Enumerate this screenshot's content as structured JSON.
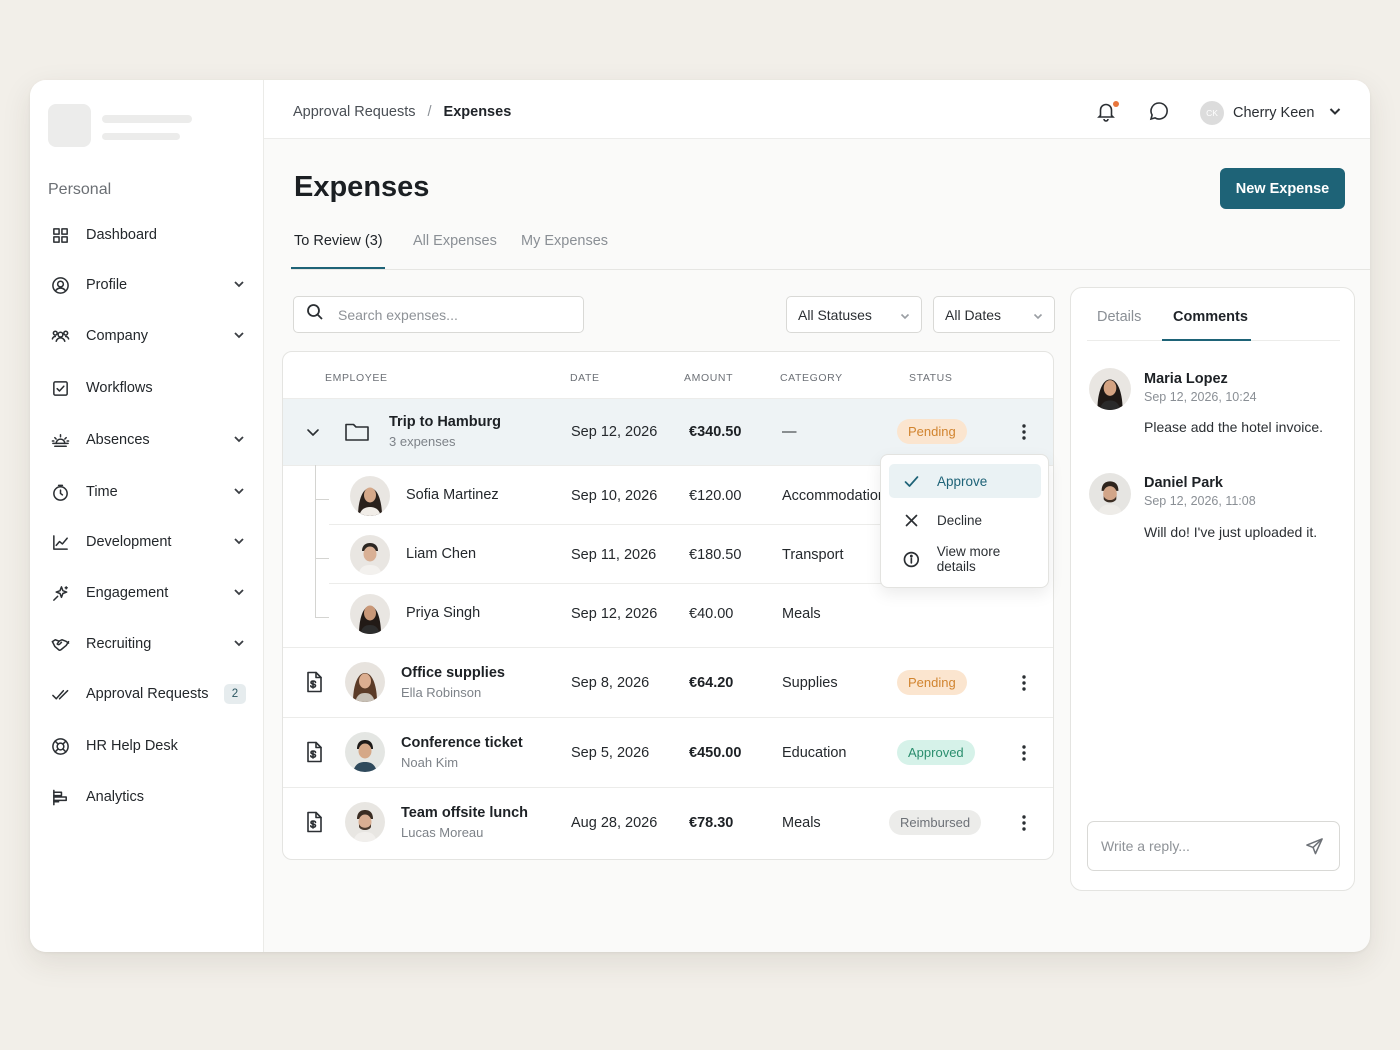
{
  "sidebar": {
    "section": "Personal",
    "items": [
      {
        "label": "Dashboard",
        "icon": "grid-icon",
        "chevron": false
      },
      {
        "label": "Profile",
        "icon": "user-circle-icon",
        "chevron": true
      },
      {
        "label": "Company",
        "icon": "users-icon",
        "chevron": true
      },
      {
        "label": "Workflows",
        "icon": "checkbox-icon",
        "chevron": false
      },
      {
        "label": "Absences",
        "icon": "sunrise-icon",
        "chevron": true
      },
      {
        "label": "Time",
        "icon": "stopwatch-icon",
        "chevron": true
      },
      {
        "label": "Development",
        "icon": "chart-line-icon",
        "chevron": true
      },
      {
        "label": "Engagement",
        "icon": "sparkle-icon",
        "chevron": true
      },
      {
        "label": "Recruiting",
        "icon": "handshake-icon",
        "chevron": true
      },
      {
        "label": "Approval Requests",
        "icon": "double-check-icon",
        "chevron": false,
        "badge": "2"
      },
      {
        "label": "HR Help Desk",
        "icon": "lifebuoy-icon",
        "chevron": false
      },
      {
        "label": "Analytics",
        "icon": "bar-chart-icon",
        "chevron": false
      }
    ]
  },
  "topbar": {
    "breadcrumb_parent": "Approval Requests",
    "breadcrumb_sep": "/",
    "breadcrumb_current": "Expenses",
    "user_initials": "CK",
    "user_name": "Cherry Keen"
  },
  "header": {
    "title": "Expenses",
    "new_button": "New Expense",
    "tabs": [
      "To Review (3)",
      "All Expenses",
      "My Expenses"
    ]
  },
  "filters": {
    "search_placeholder": "Search expenses...",
    "status": "All Statuses",
    "dates": "All Dates"
  },
  "table": {
    "headers": [
      "EMPLOYEE",
      "DATE",
      "AMOUNT",
      "CATEGORY",
      "STATUS"
    ],
    "group": {
      "title": "Trip to Hamburg",
      "sub": "3 expenses",
      "date": "Sep 12, 2026",
      "amount": "€340.50",
      "category": "—",
      "status": "Pending"
    },
    "children": [
      {
        "name": "Sofia Martinez",
        "date": "Sep 10, 2026",
        "amount": "€120.00",
        "category": "Accommodation"
      },
      {
        "name": "Liam Chen",
        "date": "Sep 11, 2026",
        "amount": "€180.50",
        "category": "Transport"
      },
      {
        "name": "Priya Singh",
        "date": "Sep 12, 2026",
        "amount": "€40.00",
        "category": "Meals"
      }
    ],
    "rows": [
      {
        "title": "Office supplies",
        "employee": "Ella Robinson",
        "date": "Sep 8, 2026",
        "amount": "€64.20",
        "category": "Supplies",
        "status": "Pending"
      },
      {
        "title": "Conference ticket",
        "employee": "Noah Kim",
        "date": "Sep 5, 2026",
        "amount": "€450.00",
        "category": "Education",
        "status": "Approved"
      },
      {
        "title": "Team offsite lunch",
        "employee": "Lucas Moreau",
        "date": "Aug 28, 2026",
        "amount": "€78.30",
        "category": "Meals",
        "status": "Reimbursed"
      }
    ]
  },
  "menu": {
    "items": [
      "Approve",
      "Decline",
      "View more details"
    ]
  },
  "panel": {
    "tabs": [
      "Details",
      "Comments"
    ],
    "comments": [
      {
        "name": "Maria Lopez",
        "time": "Sep 12, 2026, 10:24",
        "text": "Please add the hotel invoice."
      },
      {
        "name": "Daniel Park",
        "time": "Sep 12, 2026, 11:08",
        "text": "Will do! I've just uploaded it."
      }
    ],
    "reply_placeholder": "Write a reply..."
  },
  "colors": {
    "accent": "#1e6377",
    "pending_bg": "#fbe5cf",
    "approved_bg": "#d6f2e9",
    "reimbursed_bg": "#ececea"
  }
}
